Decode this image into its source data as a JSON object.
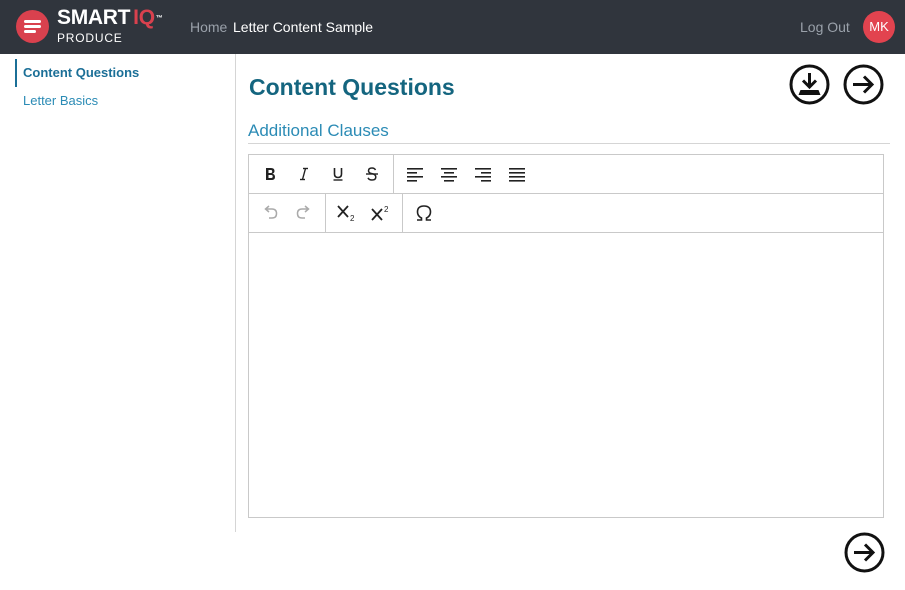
{
  "header": {
    "brand_smart": "SMART",
    "brand_iq": "IQ",
    "brand_tm": "™",
    "brand_sub": "PRODUCE",
    "breadcrumb_home": "Home",
    "breadcrumb_current": "Letter Content Sample",
    "logout_label": "Log Out",
    "avatar_initials": "MK"
  },
  "sidebar": {
    "items": [
      {
        "label": "Content Questions",
        "active": true
      },
      {
        "label": "Letter Basics",
        "active": false
      }
    ]
  },
  "main": {
    "title": "Content Questions",
    "section_title": "Additional Clauses"
  },
  "editor": {
    "toolbar_row1": [
      "bold-icon",
      "italic-icon",
      "underline-icon",
      "strikethrough-icon",
      "align-left-icon",
      "align-center-icon",
      "align-right-icon",
      "align-justify-icon"
    ],
    "toolbar_row2": [
      "undo-icon",
      "redo-icon",
      "subscript-icon",
      "superscript-icon",
      "omega-icon"
    ],
    "content": ""
  },
  "colors": {
    "header_bg": "#30353d",
    "brand_red": "#d9414e",
    "title_teal": "#14657f",
    "link_blue": "#2b8bb5"
  }
}
